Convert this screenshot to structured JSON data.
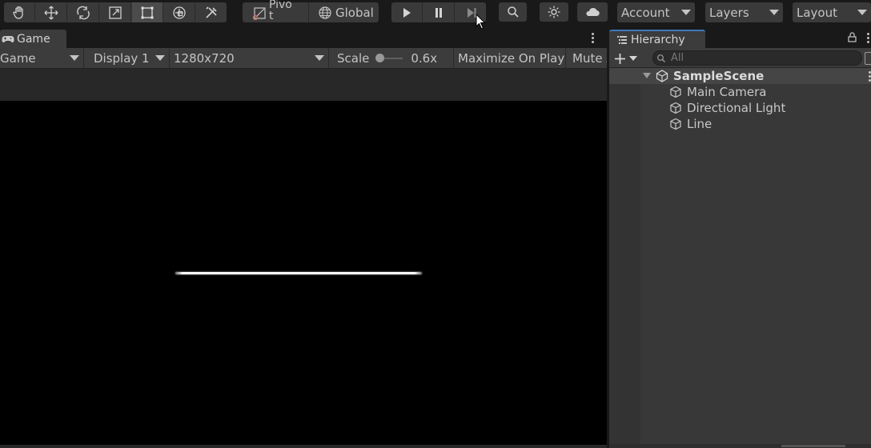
{
  "toolbar": {
    "tools": [
      {
        "name": "hand-tool",
        "icon": "hand-icon",
        "selected": false
      },
      {
        "name": "move-tool",
        "icon": "move-icon",
        "selected": false
      },
      {
        "name": "rotate-tool",
        "icon": "rotate-icon",
        "selected": false
      },
      {
        "name": "scale-tool",
        "icon": "scale-icon",
        "selected": false
      },
      {
        "name": "rect-tool",
        "icon": "rect-transform-icon",
        "selected": true
      },
      {
        "name": "transform-tool",
        "icon": "transform-icon",
        "selected": false
      },
      {
        "name": "custom-tool",
        "icon": "custom-tools-icon",
        "selected": false
      }
    ],
    "pivot_label": "Pivo\nt",
    "pivot_label_line1": "Pivo",
    "pivot_label_line2": "t",
    "global_label": "Global",
    "account_label": "Account",
    "layers_label": "Layers",
    "layout_label": "Layout"
  },
  "game_panel": {
    "tab_label": "Game",
    "view_mode": "Game",
    "display": "Display 1",
    "resolution": "1280x720",
    "scale_label": "Scale",
    "scale_value": "0.6x",
    "maximize_label": "Maximize On Play",
    "mute_label": "Mute A"
  },
  "hierarchy": {
    "tab_label": "Hierarchy",
    "search_placeholder": "All",
    "scene": "SampleScene",
    "objects": [
      "Main Camera",
      "Directional Light",
      "Line"
    ]
  },
  "colors": {
    "accent": "#3a79bb",
    "panel_bg": "#383838",
    "toolbar_bg": "#191919"
  }
}
